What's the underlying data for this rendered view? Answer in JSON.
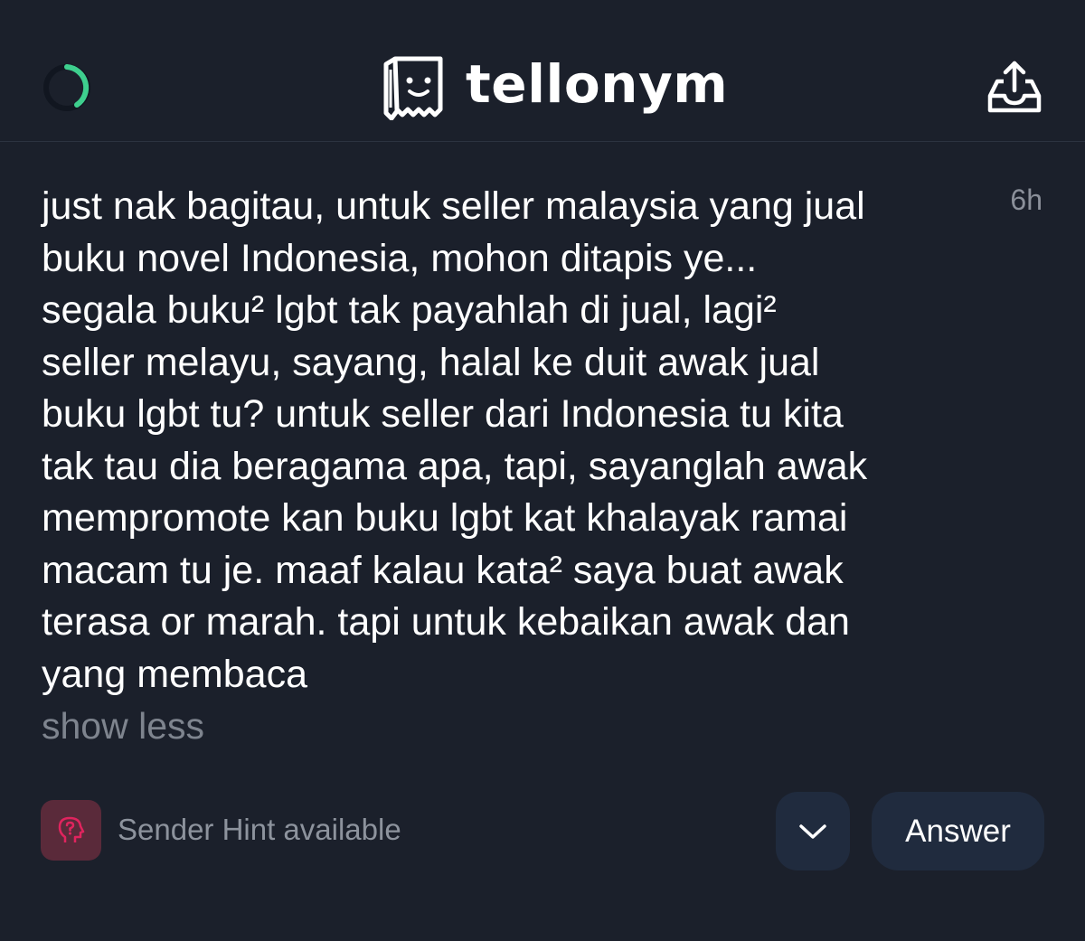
{
  "header": {
    "brand_name": "tellonym",
    "spinner_color": "#3ecf8e"
  },
  "tell": {
    "timestamp": "6h",
    "message": "just nak bagitau, untuk seller malaysia yang jual\nbuku novel Indonesia, mohon ditapis ye...\nsegala buku² lgbt tak payahlah di jual, lagi²\nseller melayu, sayang, halal ke duit awak jual\nbuku lgbt tu? untuk seller dari Indonesia tu kita\ntak tau dia beragama apa, tapi, sayanglah awak\nmempromote kan buku lgbt kat khalayak ramai\nmacam tu je. maaf kalau kata² saya buat awak\nterasa or marah. tapi untuk kebaikan awak dan\nyang membaca",
    "show_less_label": "show less"
  },
  "footer": {
    "sender_hint_label": "Sender Hint available",
    "answer_label": "Answer",
    "hint_icon": "question-head-icon",
    "hint_color": "#e0245e"
  }
}
